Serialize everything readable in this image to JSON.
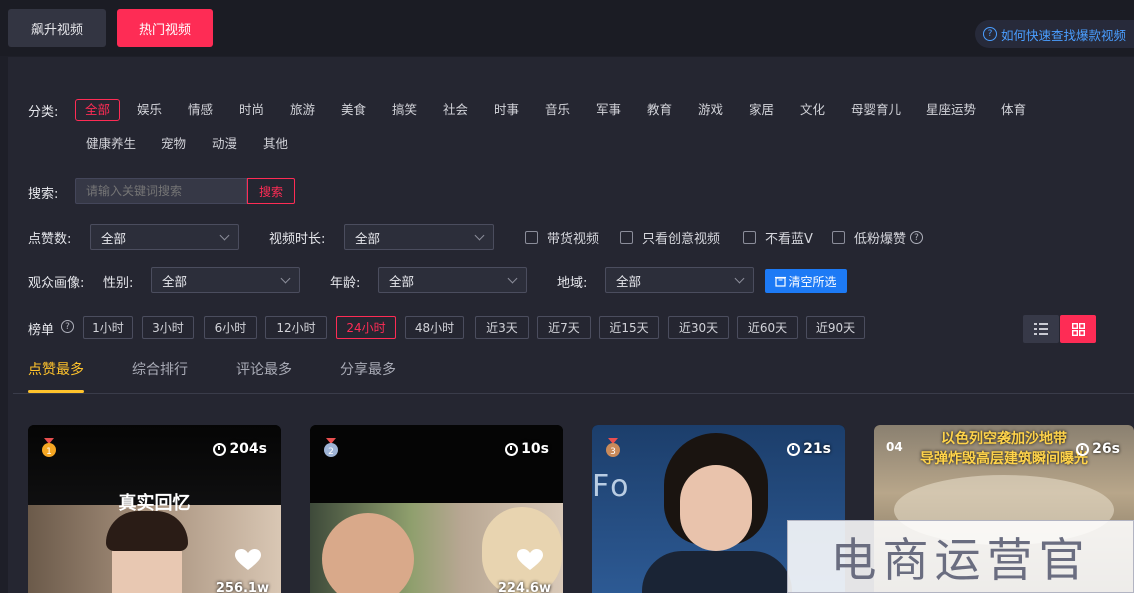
{
  "top_tabs": {
    "rising": "飙升视频",
    "hot": "热门视频"
  },
  "help_link": "如何快速查找爆款视频",
  "category": {
    "label": "分类:",
    "items": [
      "全部",
      "娱乐",
      "情感",
      "时尚",
      "旅游",
      "美食",
      "搞笑",
      "社会",
      "时事",
      "音乐",
      "军事",
      "教育",
      "游戏",
      "家居",
      "文化",
      "母婴育儿",
      "星座运势",
      "体育",
      "健康养生",
      "宠物",
      "动漫",
      "其他"
    ],
    "active": "全部"
  },
  "search": {
    "label": "搜索:",
    "placeholder": "请输入关键词搜索",
    "button": "搜索"
  },
  "filters": {
    "likes_label": "点赞数:",
    "likes_value": "全部",
    "duration_label": "视频时长:",
    "duration_value": "全部",
    "checkboxes": [
      "带货视频",
      "只看创意视频",
      "不看蓝V",
      "低粉爆赞"
    ]
  },
  "audience": {
    "label": "观众画像:",
    "gender_label": "性别:",
    "gender_value": "全部",
    "age_label": "年龄:",
    "age_value": "全部",
    "region_label": "地域:",
    "region_value": "全部",
    "clear_button": "清空所选"
  },
  "rank_list": {
    "label": "榜单",
    "periods": [
      "1小时",
      "3小时",
      "6小时",
      "12小时",
      "24小时",
      "48小时",
      "近3天",
      "近7天",
      "近15天",
      "近30天",
      "近60天",
      "近90天"
    ],
    "active": "24小时"
  },
  "sort_tabs": [
    "点赞最多",
    "综合排行",
    "评论最多",
    "分享最多"
  ],
  "cards": [
    {
      "rank": "1",
      "duration": "204s",
      "likes": "256.1w",
      "caption": "真实回忆",
      "medal_color": "#f5a623"
    },
    {
      "rank": "2",
      "duration": "10s",
      "likes": "224.6w",
      "medal_color": "#9fb4d6"
    },
    {
      "rank": "3",
      "duration": "21s",
      "caption": "Fo    Aft",
      "medal_color": "#c98a5a"
    },
    {
      "rank": "04",
      "duration": "26s",
      "caption": "以色列空袭加沙地带\n导弹炸毁高层建筑瞬间曝光"
    }
  ],
  "watermark": "电商运营官",
  "colors": {
    "accent": "#fe2c55",
    "active_tab": "#ffc32c",
    "link": "#4a9eff",
    "clear_button": "#1d7af5"
  }
}
